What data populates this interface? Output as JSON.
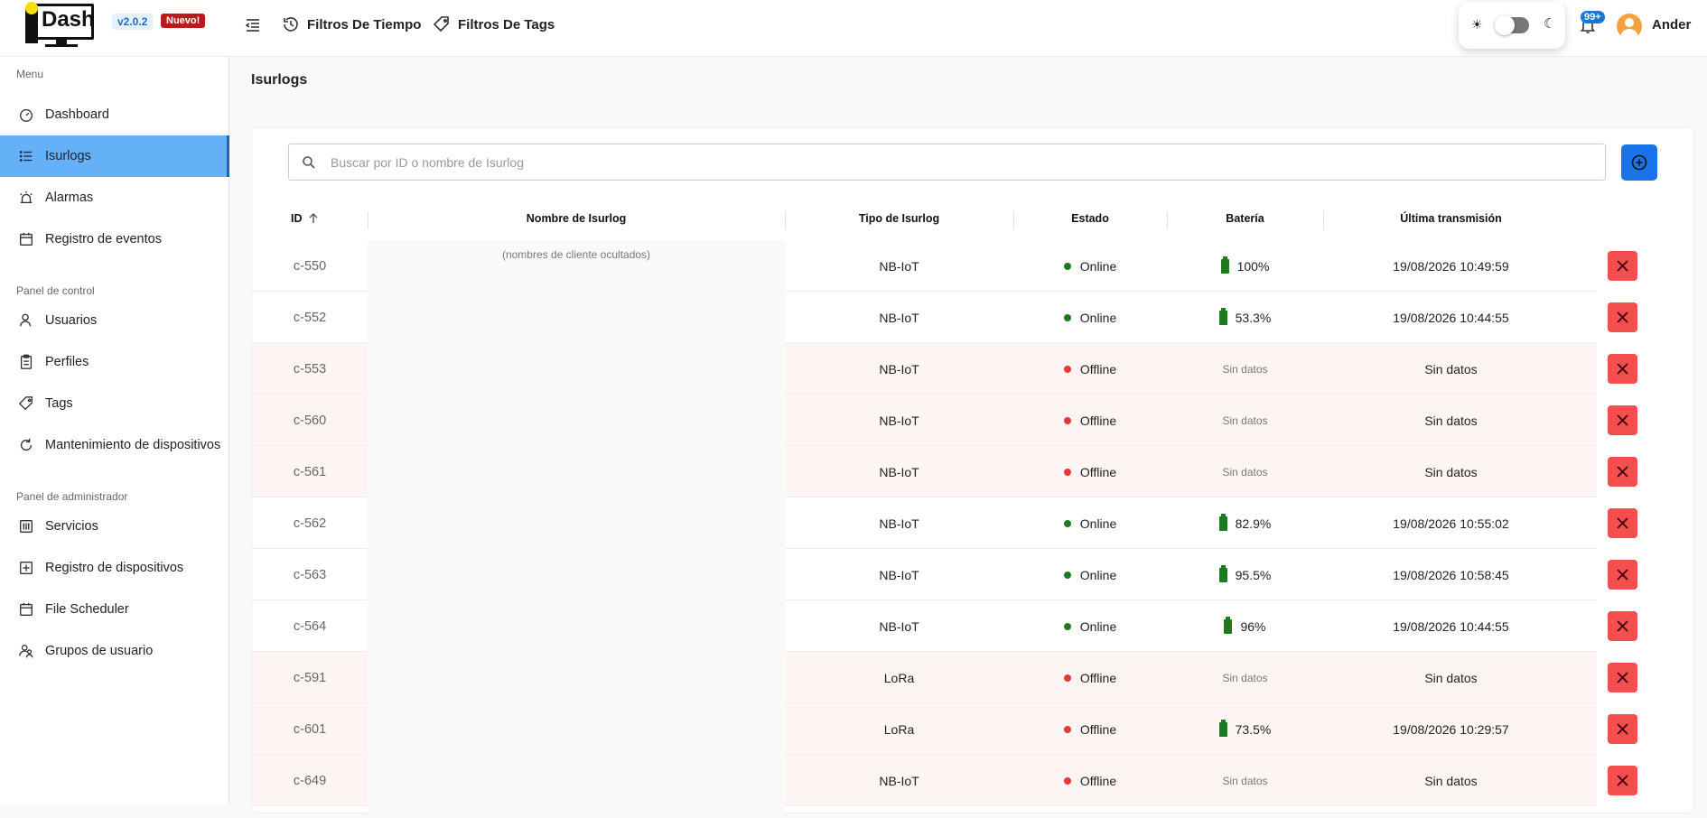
{
  "header": {
    "logo_text": "Dash",
    "version": "v2.0.2",
    "new_badge": "Nuevo!",
    "time_filters": "Filtros De Tiempo",
    "tag_filters": "Filtros De Tags",
    "notifications_count": "99+",
    "user_name": "Ander",
    "sun_glyph": "☀",
    "moon_glyph": "☾"
  },
  "sidebar": {
    "section_menu": "Menu",
    "section_control": "Panel de control",
    "section_admin": "Panel de administrador",
    "items": [
      {
        "label": "Dashboard",
        "icon": "gauge-icon"
      },
      {
        "label": "Isurlogs",
        "icon": "list-icon",
        "active": true
      },
      {
        "label": "Alarmas",
        "icon": "alarm-icon"
      },
      {
        "label": "Registro de eventos",
        "icon": "calendar-icon"
      },
      {
        "label": "Usuarios",
        "icon": "user-icon"
      },
      {
        "label": "Perfiles",
        "icon": "clipboard-icon"
      },
      {
        "label": "Tags",
        "icon": "tag-icon"
      },
      {
        "label": "Mantenimiento de dispositivos",
        "icon": "refresh-icon"
      },
      {
        "label": "Servicios",
        "icon": "sliders-icon"
      },
      {
        "label": "Registro de dispositivos",
        "icon": "plus-square-icon"
      },
      {
        "label": "File Scheduler",
        "icon": "calendar-icon"
      },
      {
        "label": "Grupos de usuario",
        "icon": "users-icon"
      }
    ]
  },
  "main": {
    "page_title": "Isurlogs",
    "search_placeholder": "Buscar por ID o nombre de Isurlog",
    "hidden_names_note": "(nombres de cliente ocultados)",
    "columns": {
      "id": "ID",
      "name": "Nombre de Isurlog",
      "tipo": "Tipo de Isurlog",
      "estado": "Estado",
      "bateria": "Batería",
      "ultima": "Última transmisión"
    },
    "status_colors": {
      "online": "#1e7a1e",
      "offline": "#e53935"
    },
    "rows": [
      {
        "id": "c-550",
        "tipo": "NB-IoT",
        "estado": "Online",
        "bateria": "100%",
        "ultima": "19/08/2026 10:49:59"
      },
      {
        "id": "c-552",
        "tipo": "NB-IoT",
        "estado": "Online",
        "bateria": "53.3%",
        "ultima": "19/08/2026 10:44:55"
      },
      {
        "id": "c-553",
        "tipo": "NB-IoT",
        "estado": "Offline",
        "bateria": "Sin datos",
        "ultima": "Sin datos"
      },
      {
        "id": "c-560",
        "tipo": "NB-IoT",
        "estado": "Offline",
        "bateria": "Sin datos",
        "ultima": "Sin datos"
      },
      {
        "id": "c-561",
        "tipo": "NB-IoT",
        "estado": "Offline",
        "bateria": "Sin datos",
        "ultima": "Sin datos"
      },
      {
        "id": "c-562",
        "tipo": "NB-IoT",
        "estado": "Online",
        "bateria": "82.9%",
        "ultima": "19/08/2026 10:55:02"
      },
      {
        "id": "c-563",
        "tipo": "NB-IoT",
        "estado": "Online",
        "bateria": "95.5%",
        "ultima": "19/08/2026 10:58:45"
      },
      {
        "id": "c-564",
        "tipo": "NB-IoT",
        "estado": "Online",
        "bateria": "96%",
        "ultima": "19/08/2026 10:44:55"
      },
      {
        "id": "c-591",
        "tipo": "LoRa",
        "estado": "Offline",
        "bateria": "Sin datos",
        "ultima": "Sin datos"
      },
      {
        "id": "c-601",
        "tipo": "LoRa",
        "estado": "Offline",
        "bateria": "73.5%",
        "ultima": "19/08/2026 10:29:57"
      },
      {
        "id": "c-649",
        "tipo": "NB-IoT",
        "estado": "Offline",
        "bateria": "Sin datos",
        "ultima": "Sin datos"
      }
    ]
  }
}
